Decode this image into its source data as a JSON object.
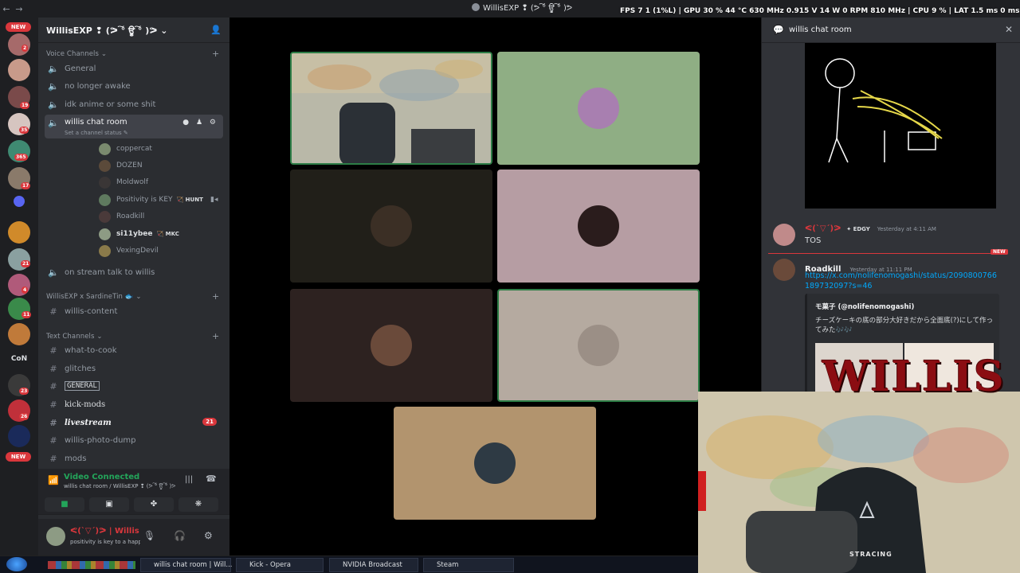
{
  "titlebar": {
    "title": "WillisEXP ❢ (ᕗ ͠° ਊ ͠° )ᕗ",
    "overlay": "FPS 7  1 (1%L) | GPU 30 % 44 °C 630 MHz 0.915 V 14 W 0 RPM 810 MHz | CPU 9 % | LAT 1.5 ms 0 ms"
  },
  "rail": {
    "new_label": "NEW",
    "con_label": "CoN",
    "badges": [
      "2",
      "19",
      "35",
      "365",
      "17",
      "21",
      "4",
      "11",
      "23",
      "26"
    ]
  },
  "server": {
    "name": "WillisEXP ❢ (ᕗ ͠° ਊ ͠° )ᕗ"
  },
  "voice_category": "Voice Channels",
  "voice_channels": [
    "General",
    "no longer awake",
    "idk anime or some shit"
  ],
  "active_channel": {
    "name": "willis chat room",
    "status": "Set a channel status"
  },
  "voice_users": [
    {
      "name": "coppercat",
      "color": "#7a8a6e"
    },
    {
      "name": "DOZEN",
      "color": "#5b4a3a"
    },
    {
      "name": "Moldwolf",
      "color": "#3a3636"
    },
    {
      "name": "Positivity is KEY",
      "tag": "HUNT",
      "color": "#5f7a5f"
    },
    {
      "name": "Roadkill",
      "color": "#4a3a3a"
    },
    {
      "name": "si11ybee",
      "tag": "MKC",
      "color": "#8d9b84"
    },
    {
      "name": "VexingDevil",
      "color": "#8a7a4a"
    }
  ],
  "stream_channel": "on stream talk to willis",
  "collab_category": "WillisEXP x SardineTin 🐟",
  "collab_channels": [
    "willis-content"
  ],
  "text_category": "Text Channels",
  "text_channels": [
    {
      "name": "what-to-cook"
    },
    {
      "name": "glitches"
    },
    {
      "name": "GENERAL"
    },
    {
      "name": "kick-mods"
    },
    {
      "name": "livestream",
      "unread": "21"
    },
    {
      "name": "willis-photo-dump"
    },
    {
      "name": "mods"
    }
  ],
  "voice_connection": {
    "status": "Video Connected",
    "sub": "willis chat room / WillisEXP ❢ (ᕗ ͠° ਊ ͠° )ᕗ"
  },
  "user": {
    "name": "ᕙ(`▽´)ᕗ | Willis",
    "status": "positivity is key to a happy li..."
  },
  "tiles": [
    {
      "bg": "#9aa59a",
      "avatar": "webcam"
    },
    {
      "bg": "#8fae84",
      "avatar": "#a87fb0"
    },
    {
      "bg": "#211f19",
      "avatar": "#3b2f25"
    },
    {
      "bg": "#b69da3",
      "avatar": "#2a1c1c"
    },
    {
      "bg": "#2d2220",
      "avatar": "#6a4a3a"
    },
    {
      "bg": "#b5aaa0",
      "avatar": "#9b8f86"
    },
    {
      "bg": "#b2946e",
      "avatar": "#2e3a44"
    }
  ],
  "chat": {
    "title": "willis chat room",
    "messages": [
      {
        "name": "ᕙ(`▽´)ᕗ",
        "tag": "EDGY",
        "time": "Yesterday at 4:11 AM",
        "text": "TOS"
      },
      {
        "name": "Roadkill",
        "time": "Yesterday at 11:11 PM",
        "link": "https://x.com/nolifenomogashi/status/2090800766189732097?s=46"
      }
    ],
    "new_label": "NEW",
    "embed": {
      "author": "モ菓子 (@nolifenomogashi)",
      "text": "チーズケーキの底の部分大好きだから全面底(?)にして作ってみた🎶🎶"
    }
  },
  "webcam": {
    "logo": "WILLIS",
    "chair_text": "STRACING"
  },
  "taskbar": {
    "items": [
      "willis chat room | Will...",
      "Kick - Opera",
      "NVIDIA Broadcast",
      "Steam"
    ]
  }
}
